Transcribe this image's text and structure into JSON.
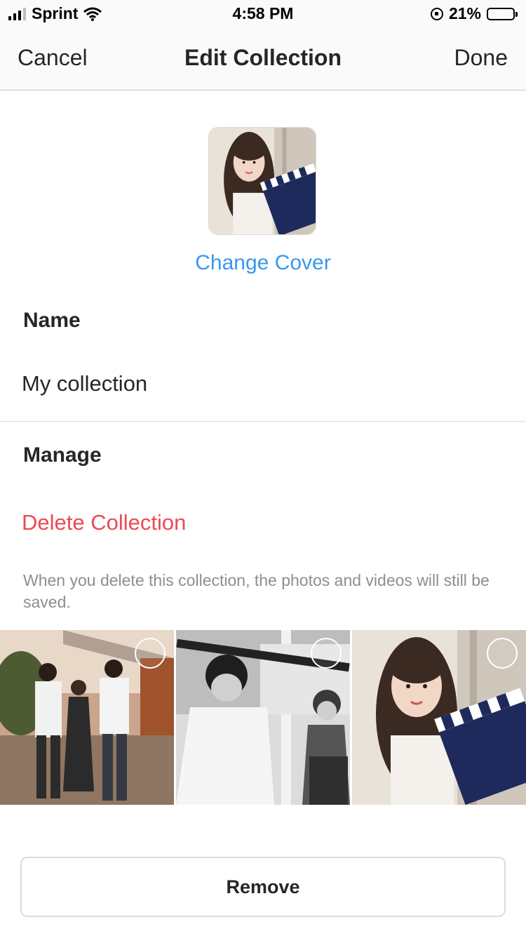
{
  "status_bar": {
    "carrier": "Sprint",
    "time": "4:58 PM",
    "battery": "21%",
    "battery_level": 0.21
  },
  "nav": {
    "cancel": "Cancel",
    "title": "Edit Collection",
    "done": "Done"
  },
  "cover": {
    "image": "cover-photo",
    "change_label": "Change Cover"
  },
  "name_section": {
    "label": "Name",
    "value": "My collection"
  },
  "manage_section": {
    "label": "Manage",
    "delete_label": "Delete Collection",
    "hint": "When you delete this collection, the photos and videos will still be saved."
  },
  "posts": [
    {
      "image": "group-photo",
      "selected": false
    },
    {
      "image": "bw-photo",
      "selected": false
    },
    {
      "image": "clapperboard-photo",
      "selected": false
    }
  ],
  "remove_button": {
    "label": "Remove"
  },
  "colors": {
    "accent": "#3897f0",
    "destructive": "#ed4956",
    "text": "#262626",
    "secondary": "#8e8e8e"
  },
  "icons": [
    "signal-icon",
    "wifi-icon",
    "rotation-lock-icon",
    "battery-icon"
  ]
}
